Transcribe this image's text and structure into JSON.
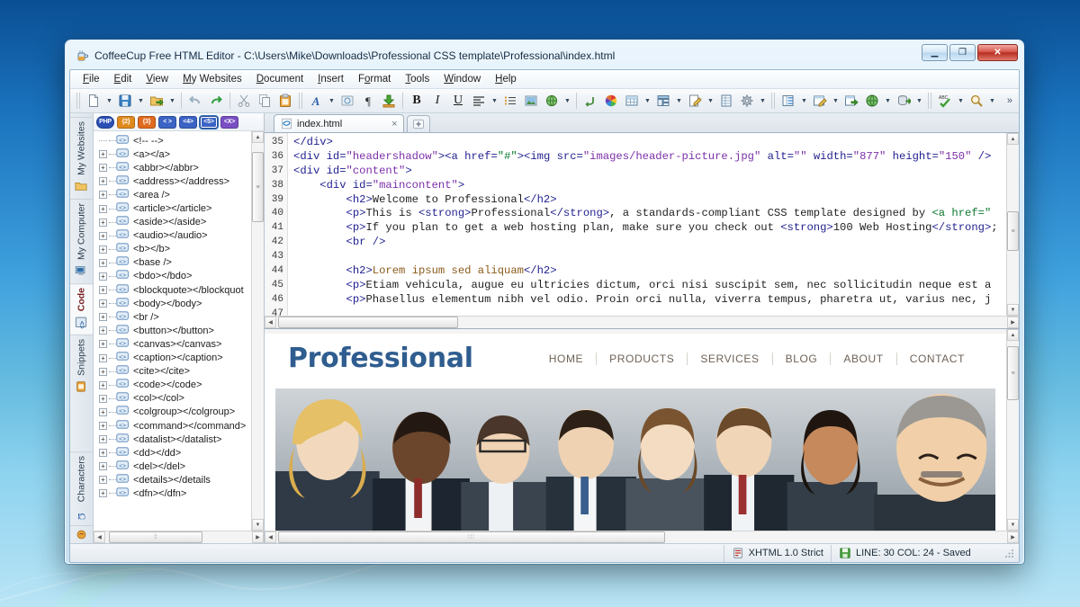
{
  "window": {
    "title": "CoffeeCup Free HTML Editor - C:\\Users\\Mike\\Downloads\\Professional CSS template\\Professional\\index.html",
    "icon": "coffeecup-icon",
    "buttons": {
      "minimize": "—",
      "maximize": "❐",
      "close": "✕"
    }
  },
  "menu": {
    "items": [
      {
        "label": "File",
        "accel": "F"
      },
      {
        "label": "Edit",
        "accel": "E"
      },
      {
        "label": "View",
        "accel": "V"
      },
      {
        "label": "My Websites",
        "accel": "M"
      },
      {
        "label": "Document",
        "accel": "D"
      },
      {
        "label": "Insert",
        "accel": "I"
      },
      {
        "label": "Format",
        "accel": "o"
      },
      {
        "label": "Tools",
        "accel": "T"
      },
      {
        "label": "Window",
        "accel": "W"
      },
      {
        "label": "Help",
        "accel": "H"
      }
    ]
  },
  "toolbar": {
    "overflow_label": "»",
    "groups": [
      {
        "buttons": [
          {
            "name": "new-document-button",
            "icon": "page-icon",
            "dropdown": true
          },
          {
            "name": "save-button",
            "icon": "floppy-disk-icon",
            "dropdown": true
          },
          {
            "name": "upload-button",
            "icon": "folder-arrow-icon",
            "dropdown": true
          }
        ]
      },
      {
        "buttons": [
          {
            "name": "undo-button",
            "icon": "undo-arrow-icon",
            "dropdown": false
          },
          {
            "name": "redo-button",
            "icon": "redo-arrow-icon",
            "dropdown": false
          }
        ]
      },
      {
        "buttons": [
          {
            "name": "cut-button",
            "icon": "scissors-icon",
            "dropdown": false
          },
          {
            "name": "copy-button",
            "icon": "copy-pages-icon",
            "dropdown": false
          },
          {
            "name": "paste-button",
            "icon": "clipboard-icon",
            "dropdown": false
          }
        ]
      },
      {
        "buttons": [
          {
            "name": "font-button",
            "icon": "letter-a-icon",
            "dropdown": true
          },
          {
            "name": "special-character-button",
            "icon": "globe-small-icon",
            "dropdown": false
          },
          {
            "name": "paragraph-button",
            "icon": "pilcrow-icon",
            "dropdown": false
          },
          {
            "name": "insert-download-button",
            "icon": "green-down-arrow-icon",
            "dropdown": false
          }
        ]
      },
      {
        "buttons": [
          {
            "name": "bold-button",
            "icon": "bold-icon",
            "dropdown": false
          },
          {
            "name": "italic-button",
            "icon": "italic-icon",
            "dropdown": false
          },
          {
            "name": "underline-button",
            "icon": "underline-icon",
            "dropdown": false
          },
          {
            "name": "align-button",
            "icon": "align-left-icon",
            "dropdown": true
          },
          {
            "name": "list-button",
            "icon": "bullet-list-icon",
            "dropdown": false
          },
          {
            "name": "insert-image-button",
            "icon": "picture-icon",
            "dropdown": false
          },
          {
            "name": "insert-link-button",
            "icon": "globe-link-icon",
            "dropdown": true
          }
        ]
      },
      {
        "buttons": [
          {
            "name": "anchor-button",
            "icon": "anchor-icon",
            "dropdown": false
          },
          {
            "name": "color-picker-button",
            "icon": "color-wheel-icon",
            "dropdown": false
          },
          {
            "name": "insert-table-button",
            "icon": "table-icon",
            "dropdown": true
          },
          {
            "name": "layout-button",
            "icon": "layout-icon",
            "dropdown": true
          },
          {
            "name": "edit-code-button",
            "icon": "pencil-page-icon",
            "dropdown": true
          },
          {
            "name": "form-button",
            "icon": "form-grid-icon",
            "dropdown": false
          },
          {
            "name": "settings-button",
            "icon": "gear-icon",
            "dropdown": true
          }
        ]
      },
      {
        "buttons": [
          {
            "name": "library-button",
            "icon": "library-icon",
            "dropdown": true
          },
          {
            "name": "design-view-button",
            "icon": "edit-window-icon",
            "dropdown": true
          },
          {
            "name": "export-button",
            "icon": "window-arrow-icon",
            "dropdown": false
          },
          {
            "name": "preview-browser-button",
            "icon": "globe-green-icon",
            "dropdown": true
          },
          {
            "name": "publish-button",
            "icon": "upload-server-icon",
            "dropdown": true
          }
        ]
      },
      {
        "buttons": [
          {
            "name": "spellcheck-button",
            "icon": "abc-check-icon",
            "dropdown": true
          },
          {
            "name": "find-button",
            "icon": "magnifier-icon",
            "dropdown": true
          }
        ]
      }
    ]
  },
  "sidebar": {
    "tabs": [
      {
        "label": "My Websites",
        "icon": "folder-icon",
        "selected": false
      },
      {
        "label": "My Computer",
        "icon": "computer-icon",
        "selected": false
      },
      {
        "label": "Code",
        "icon": "code-brackets-icon",
        "selected": true
      },
      {
        "label": "Snippets",
        "icon": "snippets-icon",
        "selected": false
      },
      {
        "label": "Characters",
        "icon": "omega-icon",
        "selected": false
      }
    ],
    "bottom_icon": "coffeecup-bean-icon"
  },
  "code_tree": {
    "language_buttons": [
      {
        "label": "PHP",
        "name": "php-filter-button",
        "color": "#2a4fb5",
        "selected": false
      },
      {
        "label": "{2}",
        "name": "css2-filter-button",
        "color": "#e08a1e",
        "selected": false
      },
      {
        "label": "{3}",
        "name": "css3-filter-button",
        "color": "#e06a1e",
        "selected": false
      },
      {
        "label": "< >",
        "name": "html-filter-button",
        "color": "#3a63c4",
        "selected": false
      },
      {
        "label": "<4>",
        "name": "html4-filter-button",
        "color": "#3a63c4",
        "selected": false
      },
      {
        "label": "<5>",
        "name": "html5-filter-button",
        "color": "#3a63c4",
        "selected": true
      },
      {
        "label": "<X>",
        "name": "xhtml-filter-button",
        "color": "#7a4fc4",
        "selected": false
      }
    ],
    "items": [
      {
        "label": "<!-- -->",
        "expandable": false
      },
      {
        "label": "<a></a>",
        "expandable": true
      },
      {
        "label": "<abbr></abbr>",
        "expandable": true
      },
      {
        "label": "<address></address>",
        "expandable": true
      },
      {
        "label": "<area />",
        "expandable": true
      },
      {
        "label": "<article></article>",
        "expandable": true
      },
      {
        "label": "<aside></aside>",
        "expandable": true
      },
      {
        "label": "<audio></audio>",
        "expandable": true
      },
      {
        "label": "<b></b>",
        "expandable": true
      },
      {
        "label": "<base />",
        "expandable": true
      },
      {
        "label": "<bdo></bdo>",
        "expandable": true
      },
      {
        "label": "<blockquote></blockquot",
        "expandable": true
      },
      {
        "label": "<body></body>",
        "expandable": true
      },
      {
        "label": "<br />",
        "expandable": true
      },
      {
        "label": "<button></button>",
        "expandable": true
      },
      {
        "label": "<canvas></canvas>",
        "expandable": true
      },
      {
        "label": "<caption></caption>",
        "expandable": true
      },
      {
        "label": "<cite></cite>",
        "expandable": true
      },
      {
        "label": "<code></code>",
        "expandable": true
      },
      {
        "label": "<col></col>",
        "expandable": true
      },
      {
        "label": "<colgroup></colgroup>",
        "expandable": true
      },
      {
        "label": "<command></command>",
        "expandable": true
      },
      {
        "label": "<datalist></datalist>",
        "expandable": true
      },
      {
        "label": "<dd></dd>",
        "expandable": true
      },
      {
        "label": "<del></del>",
        "expandable": true
      },
      {
        "label": "<details></details",
        "expandable": true
      },
      {
        "label": "<dfn></dfn>",
        "expandable": true
      }
    ]
  },
  "editor": {
    "tab": {
      "label": "index.html",
      "icon": "ie-page-icon",
      "close": "×"
    },
    "new_tab_icon": "new-tab-plus-icon",
    "first_line": 35,
    "lines": [
      {
        "n": 35,
        "segs": [
          {
            "t": "</div>",
            "c": "tg"
          }
        ]
      },
      {
        "n": 36,
        "segs": [
          {
            "t": "<div id=",
            "c": "tg"
          },
          {
            "t": "\"headershadow\"",
            "c": "vl"
          },
          {
            "t": "><a href=",
            "c": "tg"
          },
          {
            "t": "\"#\"",
            "c": "an"
          },
          {
            "t": "><img src=",
            "c": "tg"
          },
          {
            "t": "\"images/header-picture.jpg\"",
            "c": "vl"
          },
          {
            "t": " alt=",
            "c": "tg"
          },
          {
            "t": "\"\"",
            "c": "vl"
          },
          {
            "t": " width=",
            "c": "tg"
          },
          {
            "t": "\"877\"",
            "c": "vl"
          },
          {
            "t": " height=",
            "c": "tg"
          },
          {
            "t": "\"150\"",
            "c": "vl"
          },
          {
            "t": " />",
            "c": "tg"
          }
        ]
      },
      {
        "n": 37,
        "segs": [
          {
            "t": "<div id=",
            "c": "tg"
          },
          {
            "t": "\"content\"",
            "c": "vl"
          },
          {
            "t": ">",
            "c": "tg"
          }
        ]
      },
      {
        "n": 38,
        "segs": [
          {
            "t": "    <div id=",
            "c": "tg"
          },
          {
            "t": "\"maincontent\"",
            "c": "vl"
          },
          {
            "t": ">",
            "c": "tg"
          }
        ]
      },
      {
        "n": 39,
        "segs": [
          {
            "t": "        <h2>",
            "c": "tg"
          },
          {
            "t": "Welcome to Professional",
            "c": "pl"
          },
          {
            "t": "</h2>",
            "c": "tg"
          }
        ]
      },
      {
        "n": 40,
        "segs": [
          {
            "t": "        <p>",
            "c": "tg"
          },
          {
            "t": "This is ",
            "c": "pl"
          },
          {
            "t": "<strong>",
            "c": "tg"
          },
          {
            "t": "Professional",
            "c": "pl"
          },
          {
            "t": "</strong>",
            "c": "tg"
          },
          {
            "t": ", a standards-compliant CSS template designed by ",
            "c": "pl"
          },
          {
            "t": "<a href=\"",
            "c": "an"
          }
        ]
      },
      {
        "n": 41,
        "segs": [
          {
            "t": "        <p>",
            "c": "tg"
          },
          {
            "t": "If you plan to get a web hosting plan, make sure you check out ",
            "c": "pl"
          },
          {
            "t": "<strong>",
            "c": "tg"
          },
          {
            "t": "100 Web Hosting",
            "c": "pl"
          },
          {
            "t": "</strong>",
            "c": "tg"
          },
          {
            "t": ";",
            "c": "pl"
          }
        ]
      },
      {
        "n": 42,
        "segs": [
          {
            "t": "        <br />",
            "c": "tg"
          }
        ]
      },
      {
        "n": 43,
        "segs": []
      },
      {
        "n": 44,
        "segs": [
          {
            "t": "        <h2>",
            "c": "tg"
          },
          {
            "t": "Lorem ipsum sed aliquam",
            "c": "hd"
          },
          {
            "t": "</h2>",
            "c": "tg"
          }
        ]
      },
      {
        "n": 45,
        "segs": [
          {
            "t": "        <p>",
            "c": "tg"
          },
          {
            "t": "Etiam vehicula, augue eu ultricies dictum, orci nisi suscipit sem, nec sollicitudin neque est a",
            "c": "pl"
          }
        ]
      },
      {
        "n": 46,
        "segs": [
          {
            "t": "        <p>",
            "c": "tg"
          },
          {
            "t": "Phasellus elementum nibh vel odio. Proin orci nulla, viverra tempus, pharetra ut, varius nec, j",
            "c": "pl"
          }
        ]
      },
      {
        "n": 47,
        "segs": []
      }
    ]
  },
  "preview": {
    "brand": "Professional",
    "nav": [
      "HOME",
      "PRODUCTS",
      "SERVICES",
      "BLOG",
      "ABOUT",
      "CONTACT"
    ],
    "hero_alt": "group of smiling business people photo"
  },
  "statusbar": {
    "doctype_icon": "validator-icon",
    "doctype": "XHTML 1.0 Strict",
    "save_icon": "floppy-disk-green-icon",
    "position": "LINE: 30  COL: 24 - Saved"
  }
}
